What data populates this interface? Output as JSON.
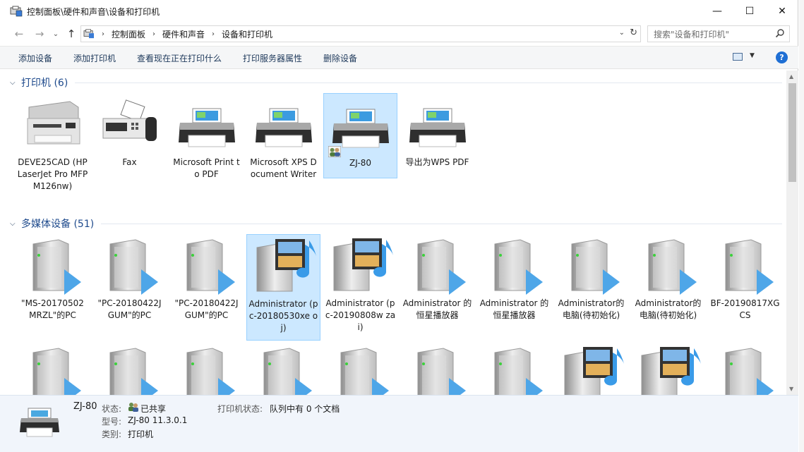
{
  "window": {
    "title": "控制面板\\硬件和声音\\设备和打印机",
    "controls": {
      "minimize": "—",
      "maximize": "☐",
      "close": "✕"
    }
  },
  "nav": {
    "back": "←",
    "forward": "→",
    "up": "↑",
    "breadcrumbs": [
      "控制面板",
      "硬件和声音",
      "设备和打印机"
    ],
    "search_placeholder": "搜索\"设备和打印机\""
  },
  "toolbar": {
    "add_device": "添加设备",
    "add_printer": "添加打印机",
    "see_printing": "查看现在正在打印什么",
    "print_server": "打印服务器属性",
    "remove_device": "删除设备",
    "help": "?"
  },
  "groups": {
    "printers": {
      "title": "打印机 (6)",
      "items": [
        {
          "label": "DEVE25CAD (HP LaserJet Pro MFP M126nw)",
          "icon": "mfp-printer-icon"
        },
        {
          "label": "Fax",
          "icon": "fax-icon"
        },
        {
          "label": "Microsoft Print to PDF",
          "icon": "printer-icon"
        },
        {
          "label": "Microsoft XPS Document Writer",
          "icon": "printer-icon"
        },
        {
          "label": "ZJ-80",
          "icon": "printer-icon",
          "selected": true,
          "shared": true
        },
        {
          "label": "导出为WPS PDF",
          "icon": "printer-icon"
        }
      ]
    },
    "multimedia": {
      "title": "多媒体设备 (51)",
      "items": [
        {
          "label": "\"MS-20170502 MRZL\"的PC",
          "icon": "media-server-icon"
        },
        {
          "label": "\"PC-20180422J GUM\"的PC",
          "icon": "media-server-icon"
        },
        {
          "label": "\"PC-20180422J GUM\"的PC",
          "icon": "media-server-icon"
        },
        {
          "label": "Administrator (pc-20180530xe oj)",
          "icon": "media-library-icon",
          "selected": true
        },
        {
          "label": "Administrator (pc-20190808w zai)",
          "icon": "media-library-icon"
        },
        {
          "label": "Administrator 的恒星播放器",
          "icon": "media-server-icon"
        },
        {
          "label": "Administrator 的恒星播放器",
          "icon": "media-server-icon"
        },
        {
          "label": "Administrator的 电脑(待初始化)",
          "icon": "media-server-icon"
        },
        {
          "label": "Administrator的 电脑(待初始化)",
          "icon": "media-server-icon"
        },
        {
          "label": "BF-20190817XG CS",
          "icon": "media-server-icon"
        }
      ],
      "row3_icons": [
        "media-server-icon",
        "media-server-icon",
        "media-server-icon",
        "media-server-icon",
        "media-server-icon",
        "media-server-icon",
        "media-server-icon",
        "media-library-icon",
        "media-library-icon",
        "media-server-icon"
      ]
    }
  },
  "details": {
    "name": "ZJ-80",
    "status_label": "状态:",
    "status_value": "已共享",
    "model_label": "型号:",
    "model_value": "ZJ-80 11.3.0.1",
    "category_label": "类别:",
    "category_value": "打印机",
    "printer_status_label": "打印机状态:",
    "printer_status_value": "队列中有 0 个文档"
  }
}
